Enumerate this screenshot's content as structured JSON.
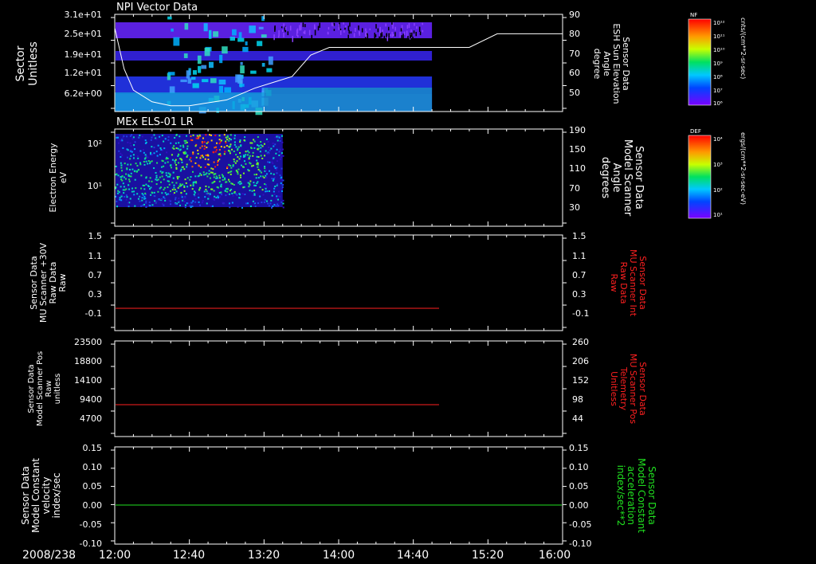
{
  "date_label": "2008/238",
  "time_ticks": [
    "12:00",
    "12:40",
    "13:20",
    "14:00",
    "14:40",
    "15:20",
    "16:00"
  ],
  "panels": [
    {
      "title": "NPI Vector Data",
      "left_label": [
        "Sector",
        "Unitless"
      ],
      "left_ticks": [
        "3.1e+01",
        "2.5e+01",
        "1.9e+01",
        "1.2e+01",
        "6.2e+00"
      ],
      "right_label": [
        "Sensor Data",
        "ESH Sun Elevation",
        "Angle",
        "degree"
      ],
      "right_ticks": [
        "90",
        "80",
        "70",
        "60",
        "50"
      ],
      "colorbar": {
        "name": "NF",
        "unit": "cnts/(cm**2-sr-sec)",
        "tick_labels": [
          "10¹²",
          "10¹¹",
          "10¹⁰",
          "10⁹",
          "10⁸",
          "10⁷",
          "10⁶"
        ]
      }
    },
    {
      "title": "MEx ELS-01 LR",
      "left_label": [
        "Electron Energy",
        "eV"
      ],
      "left_ticks": [
        "10²",
        "10¹"
      ],
      "right_label": [
        "Sensor Data",
        "Model Scanner",
        "Angle",
        "degrees"
      ],
      "right_ticks": [
        "190",
        "150",
        "110",
        "70",
        "30"
      ],
      "colorbar": {
        "name": "DEF",
        "unit": "ergs/(cm**2-sr-sec-eV)",
        "tick_labels": [
          "10⁴",
          "10³",
          "10²",
          "10¹"
        ]
      }
    },
    {
      "left_label": [
        "Sensor Data",
        "MU Scanner +30V",
        "Raw Data",
        "Raw"
      ],
      "left_ticks": [
        "1.5",
        "1.1",
        "0.7",
        "0.3",
        "-0.1"
      ],
      "right_label": [
        "Sensor Data",
        "MU Scanner Int",
        "Raw Data",
        "Raw"
      ],
      "right_ticks": [
        "1.5",
        "1.1",
        "0.7",
        "0.3",
        "-0.1"
      ]
    },
    {
      "left_label": [
        "Sensor Data",
        "Model Scanner Pos",
        "Raw",
        "unitless"
      ],
      "left_ticks": [
        "23500",
        "18800",
        "14100",
        "9400",
        "4700"
      ],
      "right_label": [
        "Sensor Data",
        "MU Scanner Pos",
        "Telemetry",
        "Unitless"
      ],
      "right_ticks": [
        "260",
        "206",
        "152",
        "98",
        "44"
      ]
    },
    {
      "left_label": [
        "Sensor Data",
        "Model Constant",
        "velocity",
        "index/sec"
      ],
      "left_ticks": [
        "0.15",
        "0.10",
        "0.05",
        "0.00",
        "-0.05",
        "-0.10"
      ],
      "right_label": [
        "Sensor Data",
        "Model Constant",
        "acceleration",
        "index/sec**2"
      ],
      "right_ticks": [
        "0.15",
        "0.10",
        "0.05",
        "0.00",
        "-0.05",
        "-0.10"
      ]
    }
  ],
  "colors": {
    "background": "#000000",
    "axis": "#ffffff",
    "red_trace": "#ff2020",
    "green_trace": "#20e020"
  },
  "chart_data": [
    {
      "type": "heatmap",
      "title": "NPI Vector Data",
      "x_range": [
        "12:00",
        "16:00"
      ],
      "data_end": "14:50",
      "ylabel": "Sector Unitless",
      "y2label": "Sensor Data ESH Sun Elevation Angle degree",
      "y2lim": [
        40,
        90
      ],
      "overlay_line": {
        "name": "Sensor Data ESH Sun Elevation Angle",
        "x_minutes": [
          0,
          5,
          10,
          20,
          30,
          40,
          60,
          75,
          85,
          95,
          105,
          115,
          125,
          150,
          170,
          190,
          205,
          225,
          240
        ],
        "values": [
          83,
          62,
          51,
          45,
          43,
          43,
          46,
          52,
          55,
          58,
          69,
          73,
          73,
          73,
          73,
          73,
          80,
          80,
          80
        ]
      }
    },
    {
      "type": "heatmap",
      "title": "MEx ELS-01 LR",
      "x_range": [
        "12:00",
        "16:00"
      ],
      "data_end": "13:30",
      "ylabel": "Electron Energy eV",
      "y2label": "Sensor Data Model Scanner Angle degrees",
      "y2lim": [
        10,
        190
      ],
      "overlay_line": {
        "name": "Sensor Data Model Scanner Angle",
        "x_minutes": [
          0,
          240
        ],
        "values": [
          10,
          10
        ]
      }
    },
    {
      "type": "line",
      "ylabel": "Sensor Data MU Scanner +30V Raw Data Raw",
      "y2label": "Sensor Data MU Scanner Int Raw Data Raw",
      "ylim": [
        -0.3,
        1.5
      ],
      "series": [
        {
          "name": "Sensor Data MU Scanner Int Raw Data",
          "x_minutes": [
            0,
            165
          ],
          "values": [
            0.0,
            0.0
          ]
        }
      ]
    },
    {
      "type": "line",
      "ylabel": "Sensor Data Model Scanner Pos Raw unitless",
      "y2label": "Sensor Data MU Scanner Pos Telemetry Unitless",
      "ylim": [
        0,
        23500
      ],
      "y2lim": [
        0,
        260
      ],
      "series": [
        {
          "name": "Sensor Data MU Scanner Pos Telemetry",
          "x_minutes": [
            0,
            165
          ],
          "values": [
            8200,
            8200
          ]
        }
      ]
    },
    {
      "type": "line",
      "ylabel": "Sensor Data Model Constant velocity index/sec",
      "y2label": "Sensor Data Model Constant acceleration index/sec**2",
      "ylim": [
        -0.1,
        0.15
      ],
      "series": [
        {
          "name": "Sensor Data Model Constant acceleration",
          "x_minutes": [
            0,
            240
          ],
          "values": [
            0.0,
            0.0
          ]
        }
      ]
    }
  ]
}
